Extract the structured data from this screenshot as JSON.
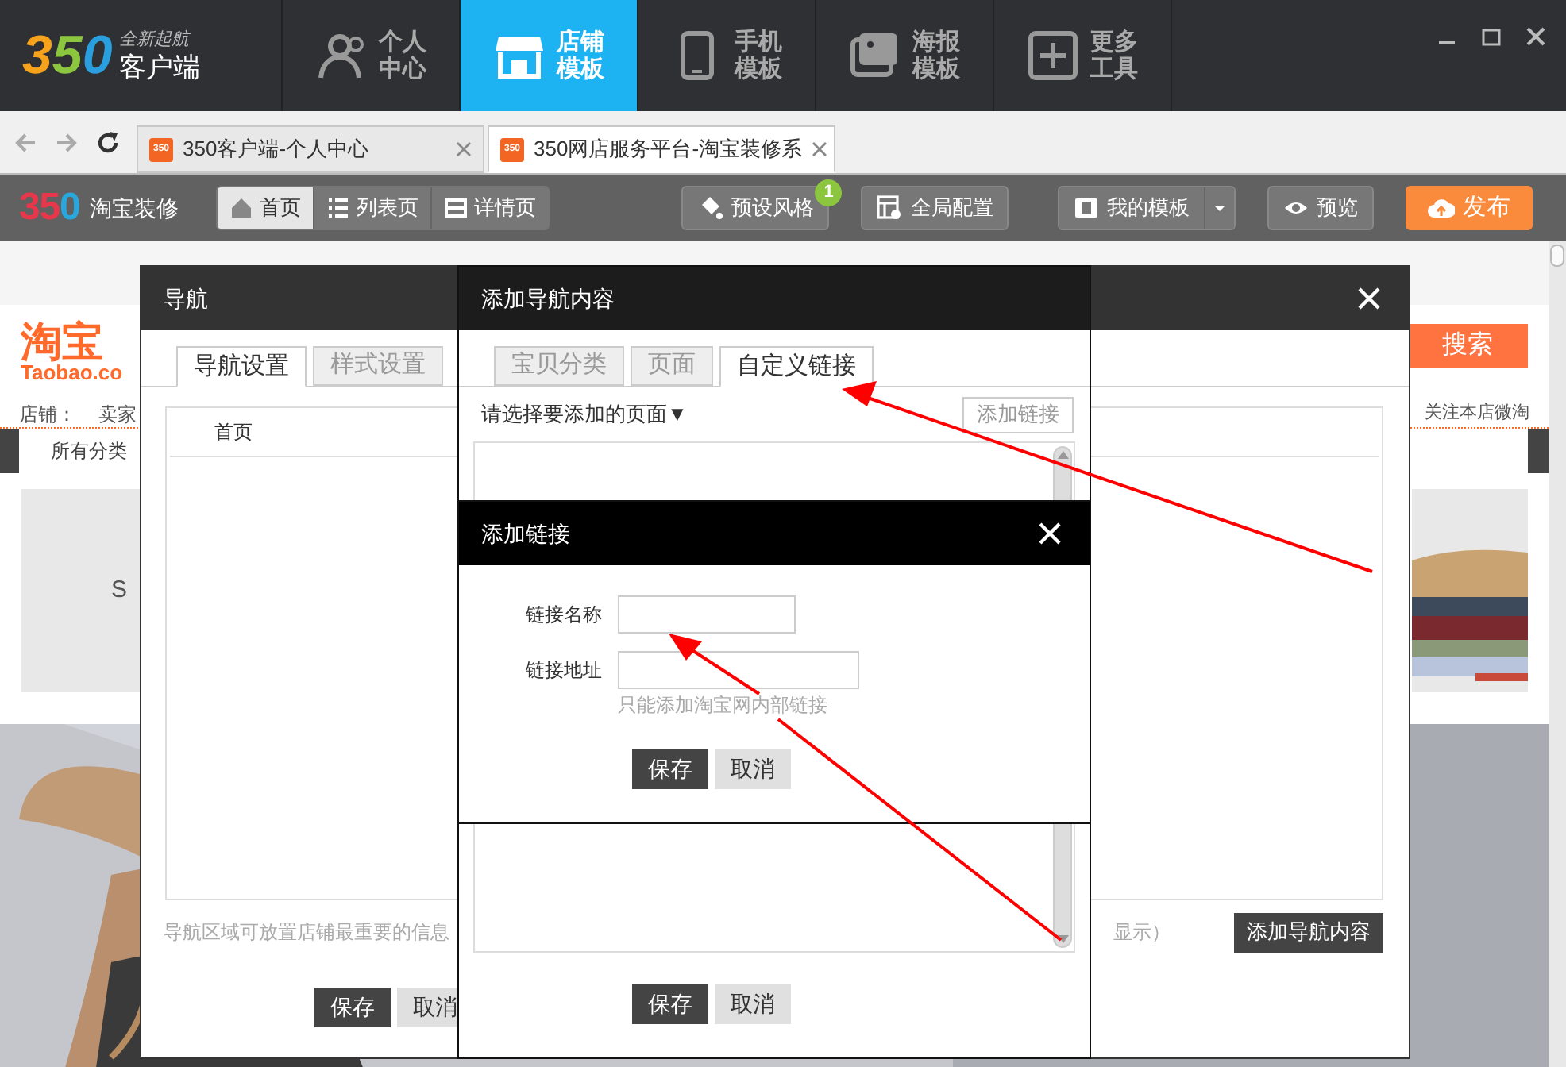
{
  "app_bar": {
    "logo": {
      "mark": "350",
      "tagline": "全新起航",
      "name": "客户端"
    },
    "nav": [
      {
        "label": "个人中心",
        "selected": false
      },
      {
        "label": "店铺模板",
        "selected": true
      },
      {
        "label": "手机模板",
        "selected": false
      },
      {
        "label": "海报模板",
        "selected": false
      },
      {
        "label": "更多工具",
        "selected": false
      }
    ]
  },
  "browser": {
    "tabs": [
      {
        "favicon": "350",
        "title": "350客户端-个人中心",
        "selected": false
      },
      {
        "favicon": "350",
        "title": "350网店服务平台-淘宝装修系",
        "selected": true
      }
    ]
  },
  "toolbar": {
    "logo": {
      "mark": "350",
      "name": "淘宝装修"
    },
    "page_tabs": [
      {
        "label": "首页",
        "selected": true
      },
      {
        "label": "列表页",
        "selected": false
      },
      {
        "label": "详情页",
        "selected": false
      }
    ],
    "style_button": {
      "label": "预设风格",
      "badge": "1"
    },
    "config_button": "全局配置",
    "templates_button": "我的模板",
    "preview_button": "预览",
    "publish_button": "发布"
  },
  "store": {
    "logo": "淘宝",
    "logo_sub": "Taobao.co",
    "shop_label": "店铺：",
    "shop_name": "卖家",
    "search_button": "搜索",
    "follow_link": "关注本店微淘",
    "category_nav": "所有分类",
    "banner_text": "S"
  },
  "nav_dialog": {
    "title": "导航",
    "tabs": [
      {
        "label": "导航设置",
        "selected": true
      },
      {
        "label": "样式设置",
        "selected": false
      }
    ],
    "list": [
      {
        "label": "首页"
      }
    ],
    "hint": "导航区域可放置店铺最重要的信息",
    "hint_end": "显示）",
    "save": "保存",
    "cancel": "取消",
    "add_button": "添加导航内容"
  },
  "add_nav_dialog": {
    "title": "添加导航内容",
    "tabs": [
      {
        "label": "宝贝分类",
        "selected": false
      },
      {
        "label": "页面",
        "selected": false
      },
      {
        "label": "自定义链接",
        "selected": true
      }
    ],
    "page_select": "请选择要添加的页面▼",
    "add_link_button": "添加链接",
    "save": "保存",
    "cancel": "取消"
  },
  "link_dialog": {
    "title": "添加链接",
    "fields": [
      {
        "label": "链接名称"
      },
      {
        "label": "链接地址",
        "hint": "只能添加淘宝网内部链接"
      }
    ],
    "save": "保存",
    "cancel": "取消"
  }
}
